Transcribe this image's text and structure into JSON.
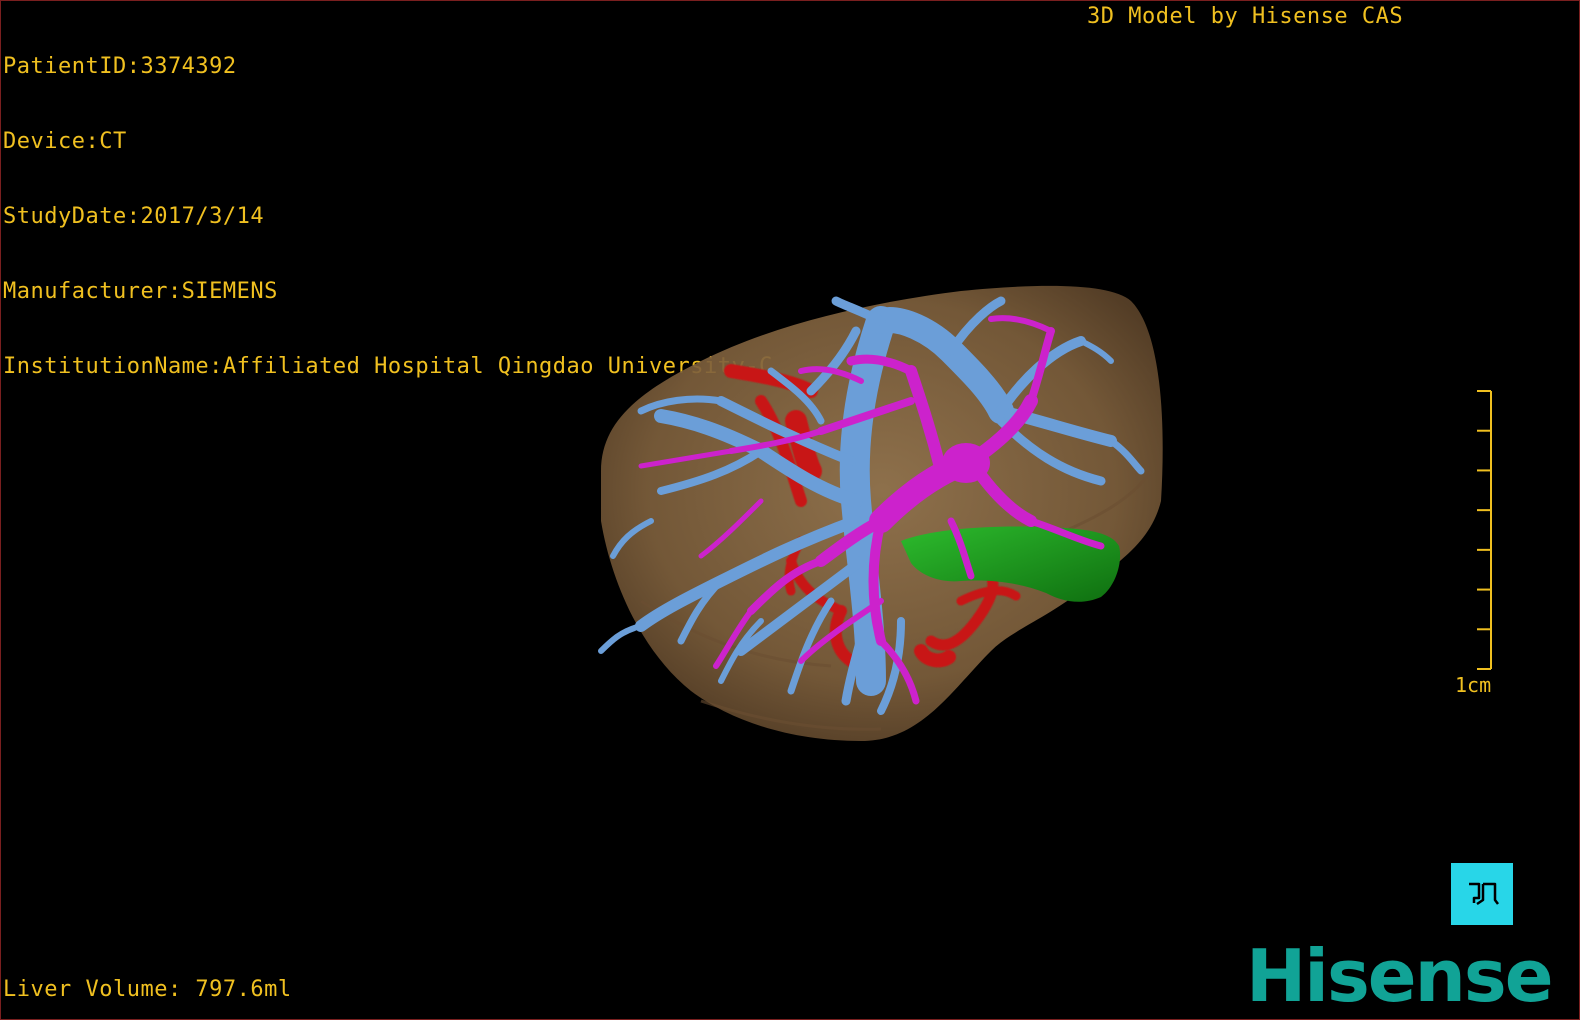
{
  "header_info": {
    "patient_id": "PatientID:3374392",
    "device": "Device:CT",
    "study_date": "StudyDate:2017/3/14",
    "manufacturer": "Manufacturer:SIEMENS",
    "institution": "InstitutionName:Affiliated Hospital Qingdao University-C"
  },
  "brand_credit": "3D Model by Hisense CAS",
  "footer": {
    "liver_volume": "Liver Volume: 797.6ml"
  },
  "scale_bar": {
    "label": "1cm",
    "ticks": 8
  },
  "view_toggle": {
    "icon": "view-orientation-icon"
  },
  "logo": {
    "text": "Hisense"
  },
  "colors": {
    "overlay_text": "#f0c020",
    "liver_parenchyma": "#8a6a45",
    "portal_vein": "#6b9ed8",
    "hepatic_vein": "#cc22cc",
    "artery": "#c81818",
    "gallbladder": "#1e9a1e",
    "toggle_button": "#28d6e8",
    "logo": "#11a396"
  }
}
